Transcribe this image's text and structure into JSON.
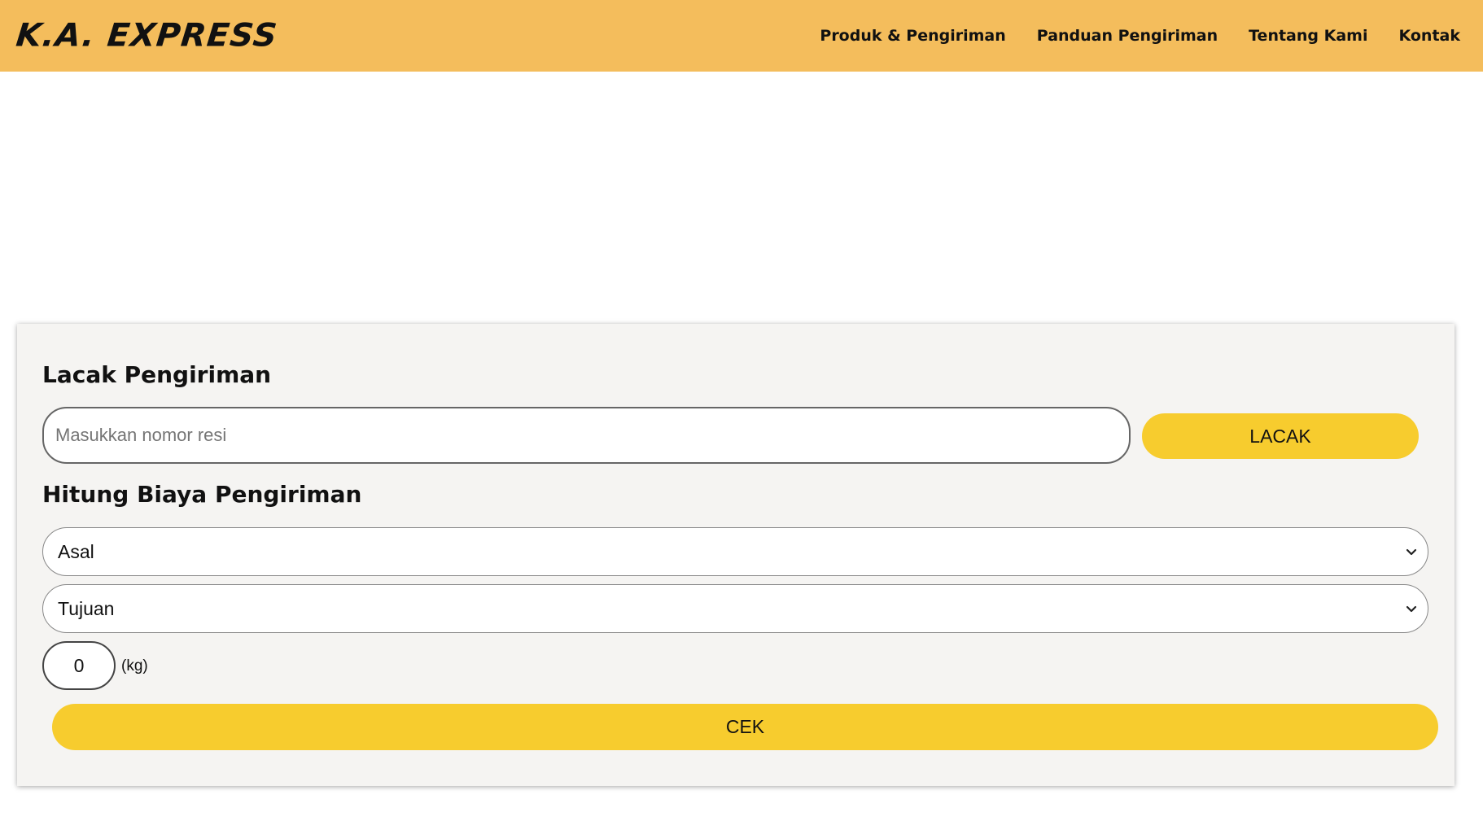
{
  "header": {
    "logo_text": "K.A. EXPRESS",
    "nav": [
      {
        "label": "Produk & Pengiriman"
      },
      {
        "label": "Panduan Pengiriman"
      },
      {
        "label": "Tentang Kami"
      },
      {
        "label": "Kontak"
      }
    ]
  },
  "tracking": {
    "title": "Lacak Pengiriman",
    "input_placeholder": "Masukkan nomor resi",
    "input_value": "",
    "button_label": "LACAK"
  },
  "cost": {
    "title": "Hitung Biaya Pengiriman",
    "origin_selected": "Asal",
    "destination_selected": "Tujuan",
    "weight_value": "0",
    "weight_unit": "(kg)",
    "button_label": "CEK"
  },
  "icons": {
    "select_arrow": "chevron-down-icon"
  },
  "colors": {
    "header_bg": "#f4bd5c",
    "button_bg": "#f7cc2e",
    "panel_bg": "#f5f4f2"
  }
}
